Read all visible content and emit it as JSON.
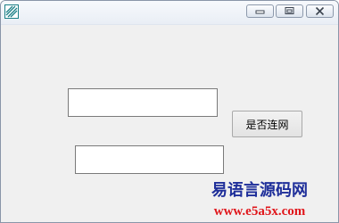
{
  "window": {
    "title": "",
    "controls": {
      "minimize_icon": "minimize-icon",
      "maximize_icon": "maximize-icon",
      "close_icon": "close-icon"
    }
  },
  "form": {
    "input1_value": "",
    "input2_value": "",
    "check_button_label": "是否连网"
  },
  "watermark": {
    "line1": "易语言源码网",
    "line2": "www.e5a5x.com"
  },
  "colors": {
    "watermark_blue": "#1f2f9a",
    "watermark_red": "#e0161b",
    "client_background": "#f0f0f0"
  }
}
